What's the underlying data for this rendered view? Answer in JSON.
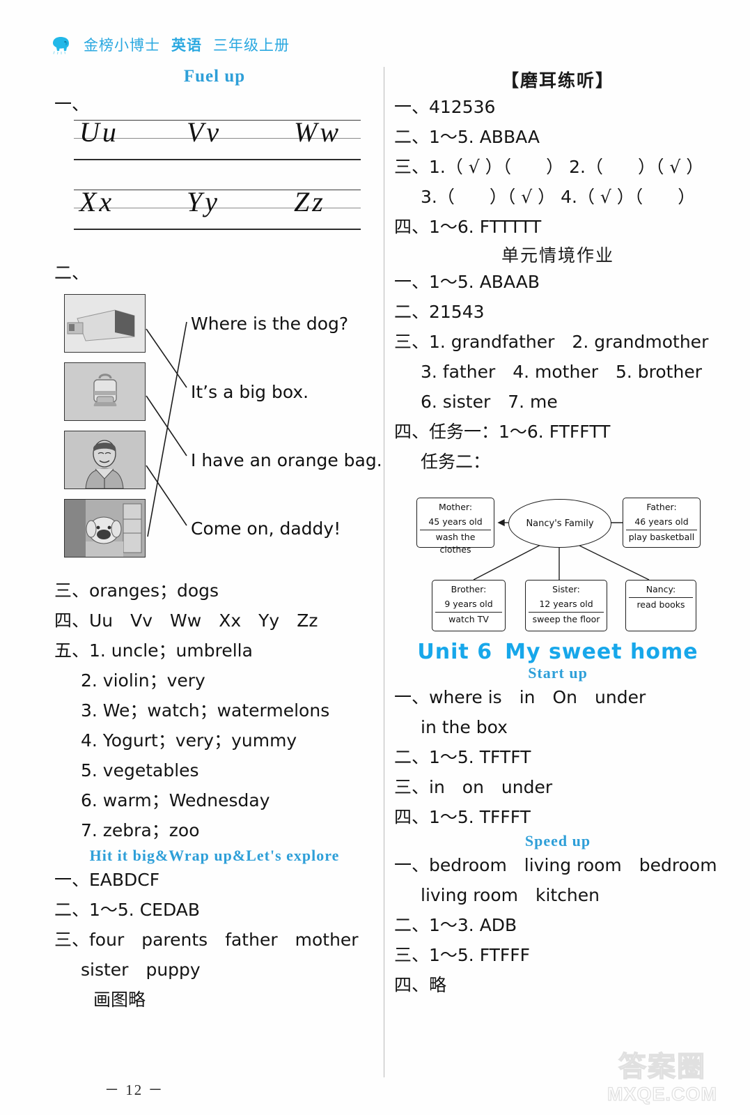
{
  "header": {
    "logo_icon": "elephant-logo-icon",
    "brand": "金榜小博士",
    "subject": "英语",
    "grade": "三年级上册",
    "brand_color": "#2aa8e0"
  },
  "left_column": {
    "section_title": "Fuel up",
    "q1": {
      "label": "一、",
      "row1": [
        "Uu",
        "Vv",
        "Ww"
      ],
      "row2": [
        "Xx",
        "Yy",
        "Zz"
      ]
    },
    "q2": {
      "label": "二、",
      "pictures": [
        "picture-box",
        "picture-backpack",
        "picture-man",
        "picture-dog"
      ],
      "sentences": [
        "Where is the dog?",
        "It’s a big box.",
        "I have an orange bag.",
        "Come on, daddy!"
      ]
    },
    "q3": "三、oranges；dogs",
    "q4": "四、Uu　Vv　Ww　Xx　Yy　Zz",
    "q5": {
      "label": "五、1. uncle；umbrella",
      "items": [
        "2. violin；very",
        "3. We；watch；watermelons",
        "4. Yogurt；very；yummy",
        "5. vegetables",
        "6. warm；Wednesday",
        "7. zebra；zoo"
      ]
    },
    "subsection_title": "Hit it big&Wrap up&Let's explore",
    "s1": "一、EABDCF",
    "s2": "二、1～5. CEDAB",
    "s3_line1": "三、four　parents　father　mother",
    "s3_line2": "sister　puppy",
    "s3_line3": "画图略"
  },
  "right_column": {
    "listening_title": "【磨耳练听】",
    "l1": "一、412536",
    "l2": "二、1～5. ABBAA",
    "l3_line1": "三、1.（ √ ）（　　） 2.（　　）（ √ ）",
    "l3_line2": "3.（　　）（ √ ） 4.（ √ ）（　　）",
    "l4": "四、1～6. FTTTTT",
    "unit_task_title": "单元情境作业",
    "u1": "一、1～5. ABAAB",
    "u2": "二、21543",
    "u3_line1": "三、1. grandfather　2. grandmother",
    "u3_line2": "3. father　4. mother　5. brother",
    "u3_line3": "6. sister　7. me",
    "u4_line1": "四、任务一：1～6. FTFFTT",
    "u4_line2": "任务二：",
    "mindmap": {
      "center": "Nancy's Family",
      "mother": {
        "title": "Mother:",
        "age": "45 years old",
        "chore": "wash the clothes"
      },
      "father": {
        "title": "Father:",
        "age": "46 years old",
        "chore": "play basketball"
      },
      "brother": {
        "title": "Brother:",
        "age": "9 years old",
        "chore": "watch TV"
      },
      "sister": {
        "title": "Sister:",
        "age": "12 years old",
        "chore": "sweep the floor"
      },
      "nancy": {
        "title": "Nancy:",
        "age": "read books",
        "chore": ""
      }
    },
    "unit6_num": "Unit 6",
    "unit6_name": "My sweet home",
    "startup_title": "Start up",
    "s1_line1": "一、where is　in　On　under",
    "s1_line2": "in the box",
    "s2": "二、1～5. TFTFT",
    "s3": "三、in　on　under",
    "s4": "四、1～5. TFFFT",
    "speedup_title": "Speed up",
    "p1_line1": "一、bedroom　living room　bedroom",
    "p1_line2": "living room　kitchen",
    "p2": "二、1～3. ADB",
    "p3": "三、1～5. FTFFF",
    "p4": "四、略"
  },
  "footer": {
    "page_number": "－ 12 －",
    "watermark_cn": "答案圈",
    "watermark_en": "MXQE.COM"
  }
}
